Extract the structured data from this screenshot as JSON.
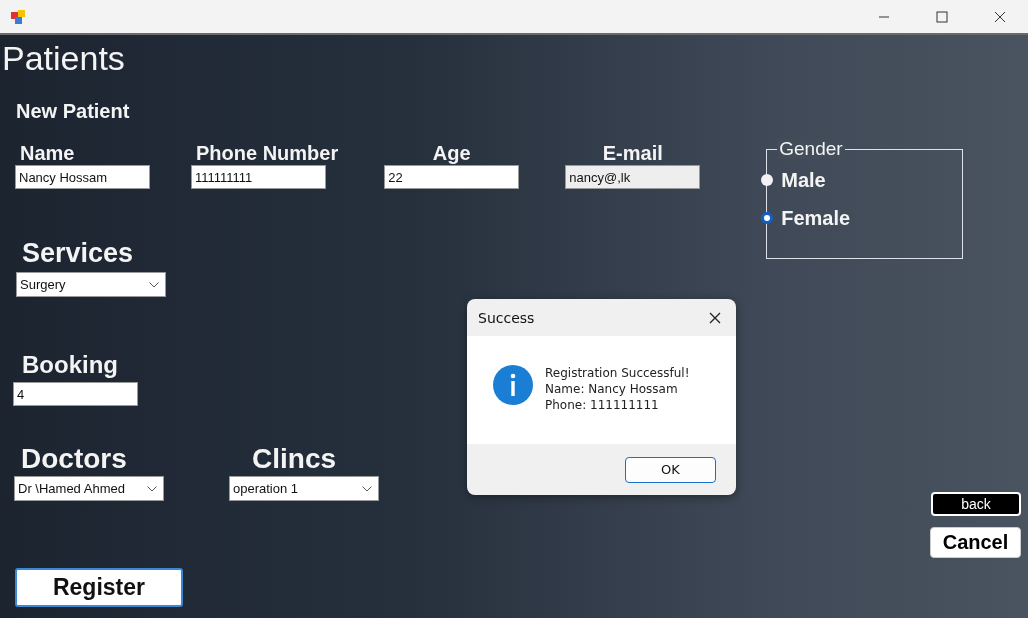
{
  "heading": "Patients",
  "subheading": "New Patient",
  "fields": [
    {
      "label": "Name",
      "value": "Nancy Hossam"
    },
    {
      "label": "Phone Number",
      "value": "111111111"
    },
    {
      "label": "Age",
      "value": "22"
    },
    {
      "label": "E-mail",
      "value": "nancy@,lk"
    }
  ],
  "gender": {
    "label": "Gender",
    "options": [
      {
        "label": "Male",
        "selected": false
      },
      {
        "label": "Female",
        "selected": true
      }
    ]
  },
  "services": {
    "label": "Services",
    "value": "Surgery"
  },
  "booking": {
    "label": "Booking",
    "value": "4"
  },
  "doctors": {
    "label": "Doctors",
    "value": "Dr \\Hamed Ahmed"
  },
  "clinics": {
    "label": "Clincs",
    "value": "operation 1"
  },
  "buttons": {
    "register": "Register",
    "back": "back",
    "cancel": "Cancel"
  },
  "dialog": {
    "title": "Success",
    "lines": [
      "Registration Successful!",
      "Name: Nancy Hossam",
      "Phone: 111111111"
    ],
    "button": "OK"
  }
}
